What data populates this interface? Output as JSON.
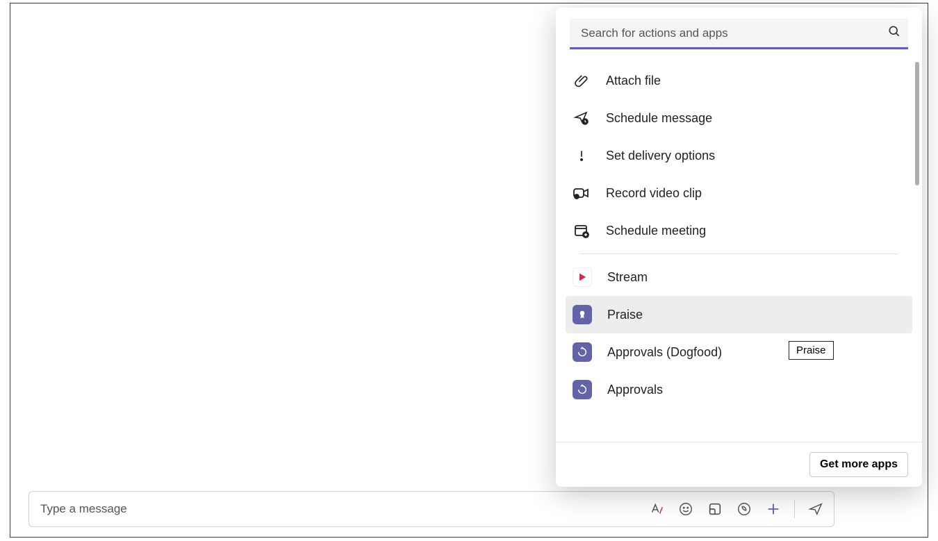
{
  "compose": {
    "placeholder": "Type a message"
  },
  "toolbar": {
    "format_icon": "format-icon",
    "emoji_icon": "emoji-icon",
    "loop_icon": "loop-icon",
    "viva_icon": "viva-icon",
    "plus_icon": "plus-icon",
    "send_icon": "send-icon"
  },
  "popup": {
    "search_placeholder": "Search for actions and apps",
    "actions": [
      {
        "id": "attach-file",
        "label": "Attach file",
        "icon": "paperclip-icon"
      },
      {
        "id": "schedule-message",
        "label": "Schedule message",
        "icon": "send-scheduled-icon"
      },
      {
        "id": "delivery-options",
        "label": "Set delivery options",
        "icon": "exclamation-icon"
      },
      {
        "id": "record-video-clip",
        "label": "Record video clip",
        "icon": "video-record-icon"
      },
      {
        "id": "schedule-meeting",
        "label": "Schedule meeting",
        "icon": "calendar-add-icon"
      }
    ],
    "apps": [
      {
        "id": "stream",
        "label": "Stream",
        "icon": "stream-app-icon",
        "bg": "white",
        "hover": false
      },
      {
        "id": "praise",
        "label": "Praise",
        "icon": "praise-app-icon",
        "bg": "violet",
        "hover": true
      },
      {
        "id": "approvals-dogfood",
        "label": "Approvals (Dogfood)",
        "icon": "approvals-app-icon",
        "bg": "violet",
        "hover": false
      },
      {
        "id": "approvals",
        "label": "Approvals",
        "icon": "approvals-app-icon",
        "bg": "violet",
        "hover": false
      }
    ],
    "footer_button": "Get more apps"
  },
  "tooltip": {
    "text": "Praise"
  }
}
